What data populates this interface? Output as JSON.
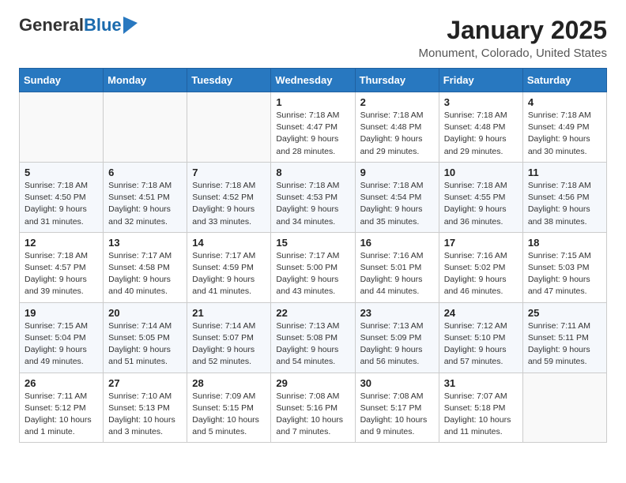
{
  "logo": {
    "general": "General",
    "blue": "Blue"
  },
  "title": {
    "month": "January 2025",
    "location": "Monument, Colorado, United States"
  },
  "weekdays": [
    "Sunday",
    "Monday",
    "Tuesday",
    "Wednesday",
    "Thursday",
    "Friday",
    "Saturday"
  ],
  "weeks": [
    [
      {
        "day": "",
        "info": ""
      },
      {
        "day": "",
        "info": ""
      },
      {
        "day": "",
        "info": ""
      },
      {
        "day": "1",
        "info": "Sunrise: 7:18 AM\nSunset: 4:47 PM\nDaylight: 9 hours\nand 28 minutes."
      },
      {
        "day": "2",
        "info": "Sunrise: 7:18 AM\nSunset: 4:48 PM\nDaylight: 9 hours\nand 29 minutes."
      },
      {
        "day": "3",
        "info": "Sunrise: 7:18 AM\nSunset: 4:48 PM\nDaylight: 9 hours\nand 29 minutes."
      },
      {
        "day": "4",
        "info": "Sunrise: 7:18 AM\nSunset: 4:49 PM\nDaylight: 9 hours\nand 30 minutes."
      }
    ],
    [
      {
        "day": "5",
        "info": "Sunrise: 7:18 AM\nSunset: 4:50 PM\nDaylight: 9 hours\nand 31 minutes."
      },
      {
        "day": "6",
        "info": "Sunrise: 7:18 AM\nSunset: 4:51 PM\nDaylight: 9 hours\nand 32 minutes."
      },
      {
        "day": "7",
        "info": "Sunrise: 7:18 AM\nSunset: 4:52 PM\nDaylight: 9 hours\nand 33 minutes."
      },
      {
        "day": "8",
        "info": "Sunrise: 7:18 AM\nSunset: 4:53 PM\nDaylight: 9 hours\nand 34 minutes."
      },
      {
        "day": "9",
        "info": "Sunrise: 7:18 AM\nSunset: 4:54 PM\nDaylight: 9 hours\nand 35 minutes."
      },
      {
        "day": "10",
        "info": "Sunrise: 7:18 AM\nSunset: 4:55 PM\nDaylight: 9 hours\nand 36 minutes."
      },
      {
        "day": "11",
        "info": "Sunrise: 7:18 AM\nSunset: 4:56 PM\nDaylight: 9 hours\nand 38 minutes."
      }
    ],
    [
      {
        "day": "12",
        "info": "Sunrise: 7:18 AM\nSunset: 4:57 PM\nDaylight: 9 hours\nand 39 minutes."
      },
      {
        "day": "13",
        "info": "Sunrise: 7:17 AM\nSunset: 4:58 PM\nDaylight: 9 hours\nand 40 minutes."
      },
      {
        "day": "14",
        "info": "Sunrise: 7:17 AM\nSunset: 4:59 PM\nDaylight: 9 hours\nand 41 minutes."
      },
      {
        "day": "15",
        "info": "Sunrise: 7:17 AM\nSunset: 5:00 PM\nDaylight: 9 hours\nand 43 minutes."
      },
      {
        "day": "16",
        "info": "Sunrise: 7:16 AM\nSunset: 5:01 PM\nDaylight: 9 hours\nand 44 minutes."
      },
      {
        "day": "17",
        "info": "Sunrise: 7:16 AM\nSunset: 5:02 PM\nDaylight: 9 hours\nand 46 minutes."
      },
      {
        "day": "18",
        "info": "Sunrise: 7:15 AM\nSunset: 5:03 PM\nDaylight: 9 hours\nand 47 minutes."
      }
    ],
    [
      {
        "day": "19",
        "info": "Sunrise: 7:15 AM\nSunset: 5:04 PM\nDaylight: 9 hours\nand 49 minutes."
      },
      {
        "day": "20",
        "info": "Sunrise: 7:14 AM\nSunset: 5:05 PM\nDaylight: 9 hours\nand 51 minutes."
      },
      {
        "day": "21",
        "info": "Sunrise: 7:14 AM\nSunset: 5:07 PM\nDaylight: 9 hours\nand 52 minutes."
      },
      {
        "day": "22",
        "info": "Sunrise: 7:13 AM\nSunset: 5:08 PM\nDaylight: 9 hours\nand 54 minutes."
      },
      {
        "day": "23",
        "info": "Sunrise: 7:13 AM\nSunset: 5:09 PM\nDaylight: 9 hours\nand 56 minutes."
      },
      {
        "day": "24",
        "info": "Sunrise: 7:12 AM\nSunset: 5:10 PM\nDaylight: 9 hours\nand 57 minutes."
      },
      {
        "day": "25",
        "info": "Sunrise: 7:11 AM\nSunset: 5:11 PM\nDaylight: 9 hours\nand 59 minutes."
      }
    ],
    [
      {
        "day": "26",
        "info": "Sunrise: 7:11 AM\nSunset: 5:12 PM\nDaylight: 10 hours\nand 1 minute."
      },
      {
        "day": "27",
        "info": "Sunrise: 7:10 AM\nSunset: 5:13 PM\nDaylight: 10 hours\nand 3 minutes."
      },
      {
        "day": "28",
        "info": "Sunrise: 7:09 AM\nSunset: 5:15 PM\nDaylight: 10 hours\nand 5 minutes."
      },
      {
        "day": "29",
        "info": "Sunrise: 7:08 AM\nSunset: 5:16 PM\nDaylight: 10 hours\nand 7 minutes."
      },
      {
        "day": "30",
        "info": "Sunrise: 7:08 AM\nSunset: 5:17 PM\nDaylight: 10 hours\nand 9 minutes."
      },
      {
        "day": "31",
        "info": "Sunrise: 7:07 AM\nSunset: 5:18 PM\nDaylight: 10 hours\nand 11 minutes."
      },
      {
        "day": "",
        "info": ""
      }
    ]
  ]
}
